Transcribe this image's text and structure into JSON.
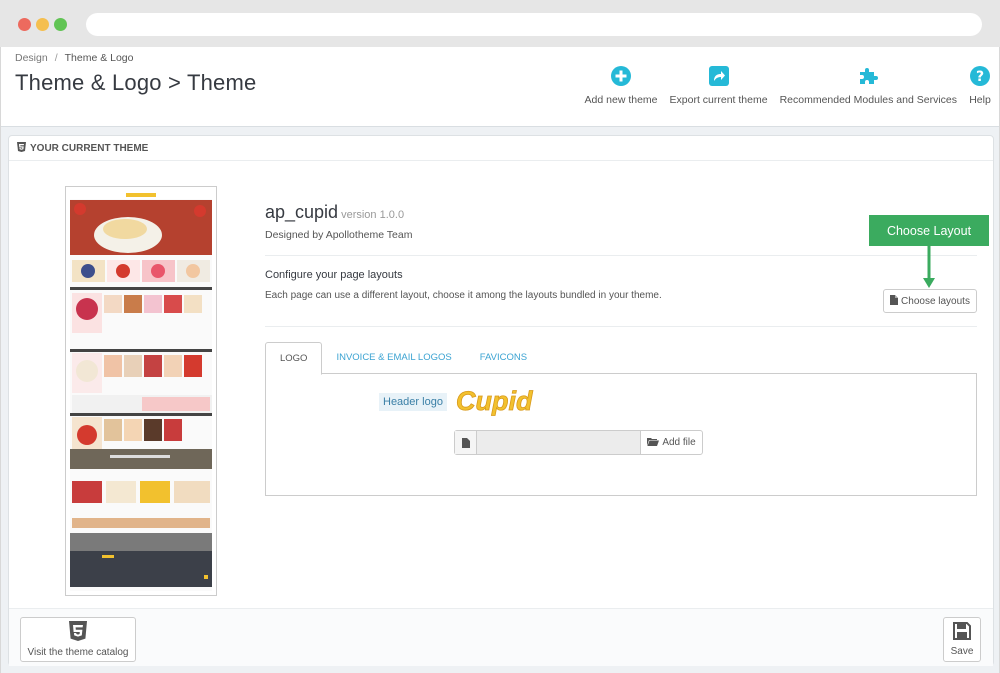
{
  "breadcrumb": {
    "parent": "Design",
    "separator": "/",
    "current": "Theme & Logo"
  },
  "page_title": "Theme & Logo > Theme",
  "toolbar": {
    "add_theme": {
      "label": "Add new theme",
      "icon": "plus-circle-icon"
    },
    "export_theme": {
      "label": "Export current theme",
      "icon": "share-icon"
    },
    "modules": {
      "label": "Recommended Modules and Services",
      "icon": "puzzle-icon"
    },
    "help": {
      "label": "Help",
      "icon": "question-circle-icon"
    }
  },
  "panel": {
    "heading": "YOUR CURRENT THEME",
    "theme_name": "ap_cupid",
    "theme_version": "version 1.0.0",
    "designer": "Designed by Apollotheme Team",
    "configure_title": "Configure your page layouts",
    "configure_desc": "Each page can use a different layout, choose it among the layouts bundled in your theme.",
    "choose_layouts_label": "Choose layouts",
    "callout_label": "Choose Layout",
    "tabs": [
      {
        "label": "LOGO",
        "active": true
      },
      {
        "label": "INVOICE & EMAIL LOGOS",
        "active": false
      },
      {
        "label": "FAVICONS",
        "active": false
      }
    ],
    "header_logo_label": "Header logo",
    "logo_text": "Cupid",
    "file_input_value": "",
    "add_file_label": "Add file"
  },
  "footer": {
    "catalog_label": "Visit the theme catalog",
    "save_label": "Save"
  },
  "colors": {
    "accent": "#25b9d7",
    "callout": "#3bab5f",
    "logo": "#f2c12e",
    "tab_link": "#3ba3d2"
  }
}
